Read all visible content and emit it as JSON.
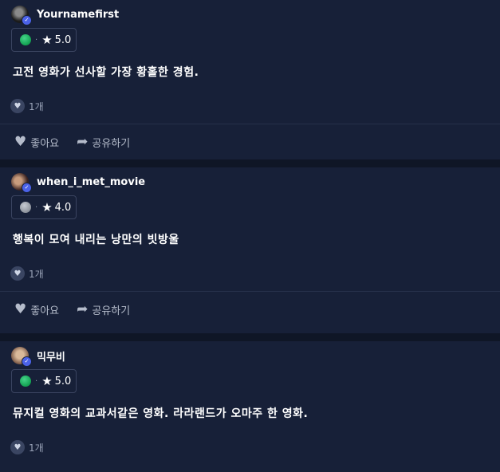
{
  "reviews": [
    {
      "username": "Yournamefirst",
      "score": "5.0",
      "status": "green",
      "text": "고전 영화가 선사할 가장 황홀한 경험.",
      "like_count": "1개",
      "like_label": "좋아요",
      "share_label": "공유하기"
    },
    {
      "username": "when_i_met_movie",
      "score": "4.0",
      "status": "gray",
      "text": "행복이 모여 내리는 낭만의 빗방울",
      "like_count": "1개",
      "like_label": "좋아요",
      "share_label": "공유하기"
    },
    {
      "username": "믹무비",
      "score": "5.0",
      "status": "green",
      "text": "뮤지컬 영화의 교과서같은 영화. 라라랜드가 오마주 한 영화.",
      "like_count": "1개"
    }
  ],
  "icons": {
    "verified": "verified-badge-icon",
    "star": "star-icon",
    "heart": "heart-icon",
    "share": "share-arrow-icon"
  },
  "colors": {
    "background": "#0f1626",
    "card": "#172038",
    "verified": "#4b62e8",
    "green": "#12a150",
    "gray": "#8d939c"
  }
}
